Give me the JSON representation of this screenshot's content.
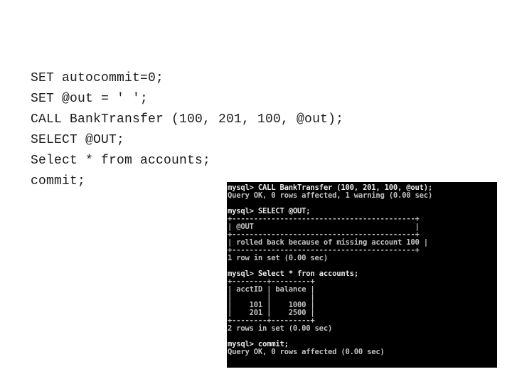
{
  "script": {
    "lines": [
      "SET autocommit=0;",
      "SET @out = ' ';",
      "CALL BankTransfer (100, 201, 100, @out);",
      "SELECT @OUT;",
      "Select * from accounts;",
      "commit;"
    ]
  },
  "terminal": {
    "lines": [
      "mysql> CALL BankTransfer (100, 201, 100, @out);",
      "Query OK, 0 rows affected, 1 warning (0.00 sec)",
      "",
      "mysql> SELECT @OUT;",
      "+------------------------------------------+",
      "| @OUT                                     |",
      "+------------------------------------------+",
      "| rolled back because of missing account 100 |",
      "+------------------------------------------+",
      "1 row in set (0.00 sec)",
      "",
      "mysql> Select * fron accounts;",
      "+--------+---------+",
      "| acctID | balance |",
      "|        |         |",
      "|    101 |    1000 |",
      "|    201 |    2500 |",
      "+--------+---------+",
      "2 rows in set (0.00 sec)",
      "",
      "mysql> commit;",
      "Query OK, 0 rows affected (0.00 sec)"
    ],
    "result_out": {
      "column": "@OUT",
      "value": "rolled back because of missing account 100"
    },
    "accounts_table": {
      "columns": [
        "acctID",
        "balance"
      ],
      "rows": [
        [
          "101",
          "1000"
        ],
        [
          "201",
          "2500"
        ]
      ]
    },
    "colors": {
      "background": "#000000",
      "text": "#c0c0c0"
    }
  }
}
